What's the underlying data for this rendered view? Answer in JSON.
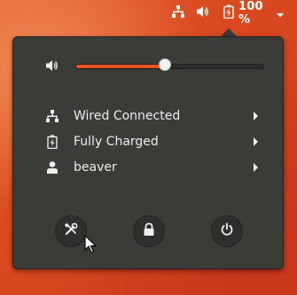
{
  "topbar": {
    "network_icon": "network-wired-icon",
    "volume_icon": "speaker-volume-icon",
    "battery_icon": "battery-charging-icon",
    "battery_percent": "100 %",
    "menu_icon": "triangle-down-icon"
  },
  "panel": {
    "volume": {
      "icon": "speaker-volume-icon",
      "level": 0.48
    },
    "items": [
      {
        "icon": "network-wired-icon",
        "label": "Wired Connected"
      },
      {
        "icon": "battery-charging-icon",
        "label": "Fully Charged"
      },
      {
        "icon": "user-icon",
        "label": "beaver"
      }
    ],
    "actions": [
      {
        "name": "settings",
        "icon": "settings-tools-icon"
      },
      {
        "name": "lock",
        "icon": "lock-icon"
      },
      {
        "name": "power",
        "icon": "power-icon"
      }
    ]
  },
  "colors": {
    "accent": "#e95420",
    "panel_bg": "#3b3b38",
    "text": "#eeeeec"
  }
}
